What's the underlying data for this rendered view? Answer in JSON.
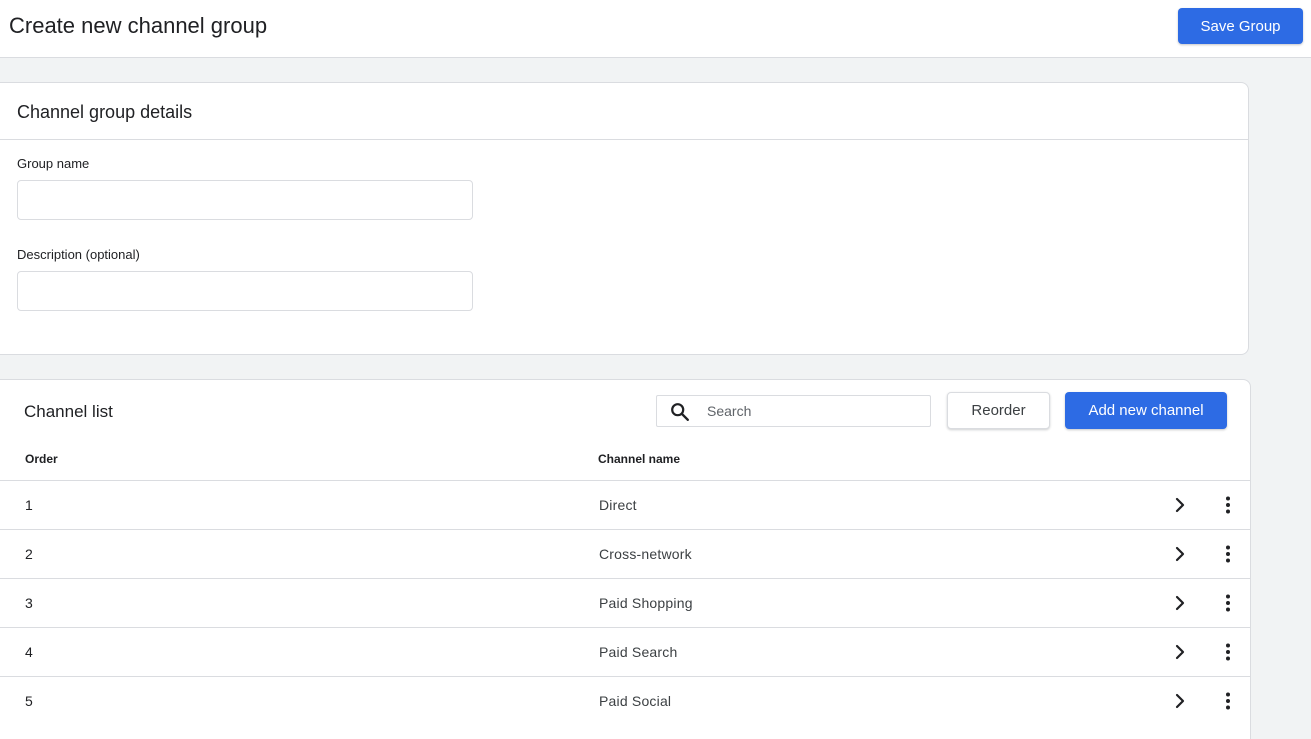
{
  "header": {
    "title": "Create new channel group",
    "save_label": "Save Group"
  },
  "details": {
    "title": "Channel group details",
    "group_name_label": "Group name",
    "group_name_value": "",
    "description_label": "Description (optional)",
    "description_value": ""
  },
  "channel_list": {
    "title": "Channel list",
    "search_placeholder": "Search",
    "reorder_label": "Reorder",
    "add_label": "Add new channel",
    "columns": [
      "Order",
      "Channel name"
    ],
    "rows": [
      {
        "order": "1",
        "name": "Direct"
      },
      {
        "order": "2",
        "name": "Cross-network"
      },
      {
        "order": "3",
        "name": "Paid Shopping"
      },
      {
        "order": "4",
        "name": "Paid Search"
      },
      {
        "order": "5",
        "name": "Paid Social"
      }
    ],
    "row_icons": [
      "chevron-right-icon",
      "more-vert-icon"
    ]
  },
  "colors": {
    "primary": "#2d6be4",
    "border": "#dadce0",
    "background": "#f1f3f4"
  }
}
